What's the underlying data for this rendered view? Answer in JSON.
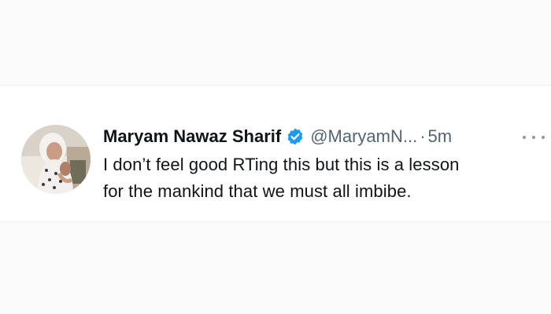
{
  "tweet": {
    "author_name": "Maryam Nawaz Sharif",
    "handle": "@MaryamN...",
    "separator": "·",
    "time": "5m",
    "text_lines": [
      "I don’t feel good RTing this but this is a lesson",
      "for the mankind that we must all imbibe."
    ],
    "verified": true,
    "verified_badge_color": "#1d9bf0",
    "more_icon": "more-horizontal-icon"
  }
}
